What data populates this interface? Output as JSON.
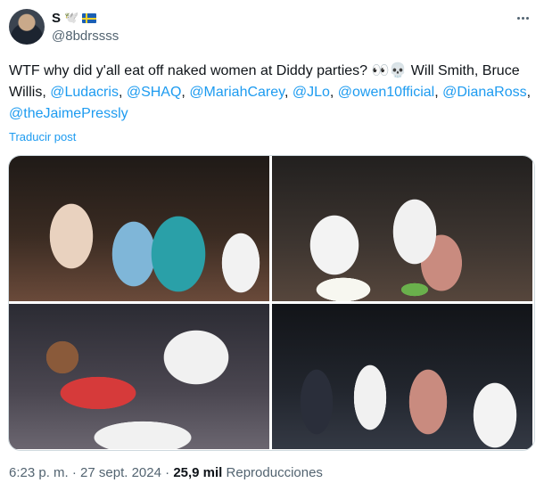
{
  "author": {
    "display_name": "S",
    "name_emoji": "🕊️",
    "flag": "Sweden flag",
    "handle": "@8bdrssss",
    "avatar_icon": "avatar-photo"
  },
  "more_icon": "more-options-icon",
  "tweet": {
    "segments": [
      {
        "text": "WTF why did y'all eat off naked women at Diddy parties? 👀💀 Will Smith, Bruce Willis, ",
        "type": "plain"
      },
      {
        "text": "@Ludacris",
        "type": "mention"
      },
      {
        "text": ", ",
        "type": "plain"
      },
      {
        "text": "@SHAQ",
        "type": "mention"
      },
      {
        "text": ", ",
        "type": "plain"
      },
      {
        "text": "@MariahCarey",
        "type": "mention"
      },
      {
        "text": ", ",
        "type": "plain"
      },
      {
        "text": "@JLo",
        "type": "mention"
      },
      {
        "text": ", ",
        "type": "plain"
      },
      {
        "text": "@owen10fficial",
        "type": "mention"
      },
      {
        "text": ", ",
        "type": "plain"
      },
      {
        "text": "@DianaRoss",
        "type": "mention"
      },
      {
        "text": ", ",
        "type": "plain"
      },
      {
        "text": "@theJaimePressly",
        "type": "mention"
      }
    ],
    "translate_label": "Traducir post"
  },
  "media": {
    "photos": [
      "party-photo-1",
      "party-photo-2",
      "party-photo-3",
      "party-photo-4"
    ]
  },
  "meta": {
    "time": "6:23 p. m.",
    "separator": "·",
    "date": "27 sept. 2024",
    "views_count": "25,9 mil",
    "views_label": "Reproducciones"
  },
  "colors": {
    "link": "#1d9bf0",
    "secondary_text": "#536471",
    "primary_text": "#0f1419"
  }
}
